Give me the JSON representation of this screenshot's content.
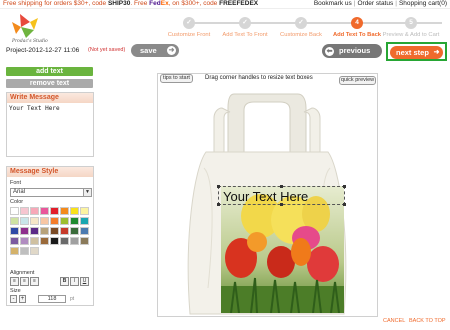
{
  "promo": {
    "text_a": "Free shipping for orders $30+, code ",
    "code_a": "SHIP30",
    "text_b": ". Free ",
    "fedex_fe": "Fed",
    "fedex_ex": "Ex",
    "text_c": ", on $300+, code ",
    "code_b": "FREEFEDEX"
  },
  "top_links": [
    "Bookmark us",
    "Order status",
    "Shopping cart(0)"
  ],
  "logo": {
    "text": "Prodac's Studio"
  },
  "steps": [
    {
      "num": "1",
      "label": "Customize Front",
      "state": "done"
    },
    {
      "num": "2",
      "label": "Add Text To Front",
      "state": "done"
    },
    {
      "num": "3",
      "label": "Customize Back",
      "state": "done"
    },
    {
      "num": "4",
      "label": "Add Text To Back",
      "state": "active"
    },
    {
      "num": "5",
      "label": "Preview & Add to Cart",
      "state": "future"
    }
  ],
  "project": {
    "name": "Project-2012-12-27 11:06",
    "status": "(Not yet saved)"
  },
  "buttons": {
    "save": "save",
    "previous": "previous",
    "next": "next step",
    "add_text": "add text",
    "remove_text": "remove text",
    "tips": "tips to start",
    "quick_preview": "quick preview"
  },
  "canvas": {
    "hint": "Drag corner handles to resize text boxes",
    "overlay_text": "Your Text Here"
  },
  "write_message": {
    "title": "Write Message",
    "value": "Your Text Here"
  },
  "message_style": {
    "title": "Message Style",
    "font_label": "Font",
    "font_value": "Arial",
    "color_label": "Color",
    "colors": [
      "#ffffff",
      "#f6c6d0",
      "#f7a8b8",
      "#e9579a",
      "#e21e2b",
      "#f38b1c",
      "#f9e11a",
      "#fbf3a0",
      "#cfe3a2",
      "#c9e6e9",
      "#f5e6c8",
      "#f7c6a3",
      "#f37c2b",
      "#9dbd2e",
      "#1f8a2f",
      "#19a6b0",
      "#2f4aa5",
      "#8e2f8c",
      "#5b2a86",
      "#b7a27a",
      "#7a4a25",
      "#c63a2a",
      "#3a6b3a",
      "#4b7ab0",
      "#7b5aa0",
      "#b08cc0",
      "#cfc0a0",
      "#9a6a3a",
      "#1a1a1a",
      "#6a6a6a",
      "#a0a0a0",
      "#8a7a5a",
      "#d4b26a",
      "#bfbfbf",
      "#e0d8c8"
    ],
    "alignment_label": "Alignment",
    "size_label": "Size",
    "size_value": "118",
    "size_unit": "pt"
  },
  "footer": {
    "cancel": "CANCEL",
    "back_to_top": "BACK TO TOP"
  },
  "colors": {
    "accent": "#f06a2c",
    "green": "#6ab43e",
    "highlight_border": "#27a634"
  }
}
